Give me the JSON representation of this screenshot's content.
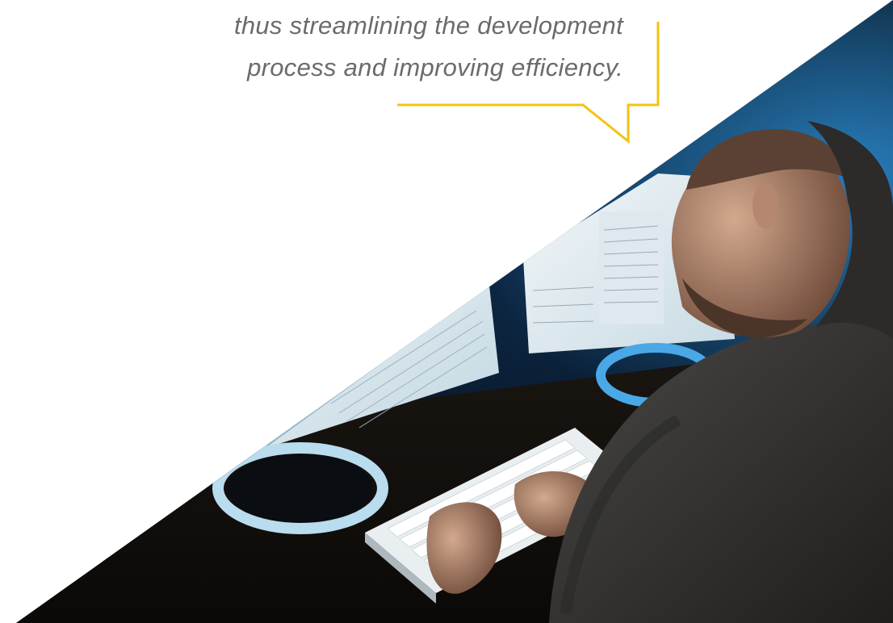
{
  "quote": {
    "lines": [
      "thus streamlining the development",
      "process and improving efficiency."
    ]
  },
  "colors": {
    "accent": "#f2c315",
    "text": "#6b6b6b",
    "background": "#ffffff"
  },
  "photo": {
    "icon": "developer-at-computer-photo"
  }
}
